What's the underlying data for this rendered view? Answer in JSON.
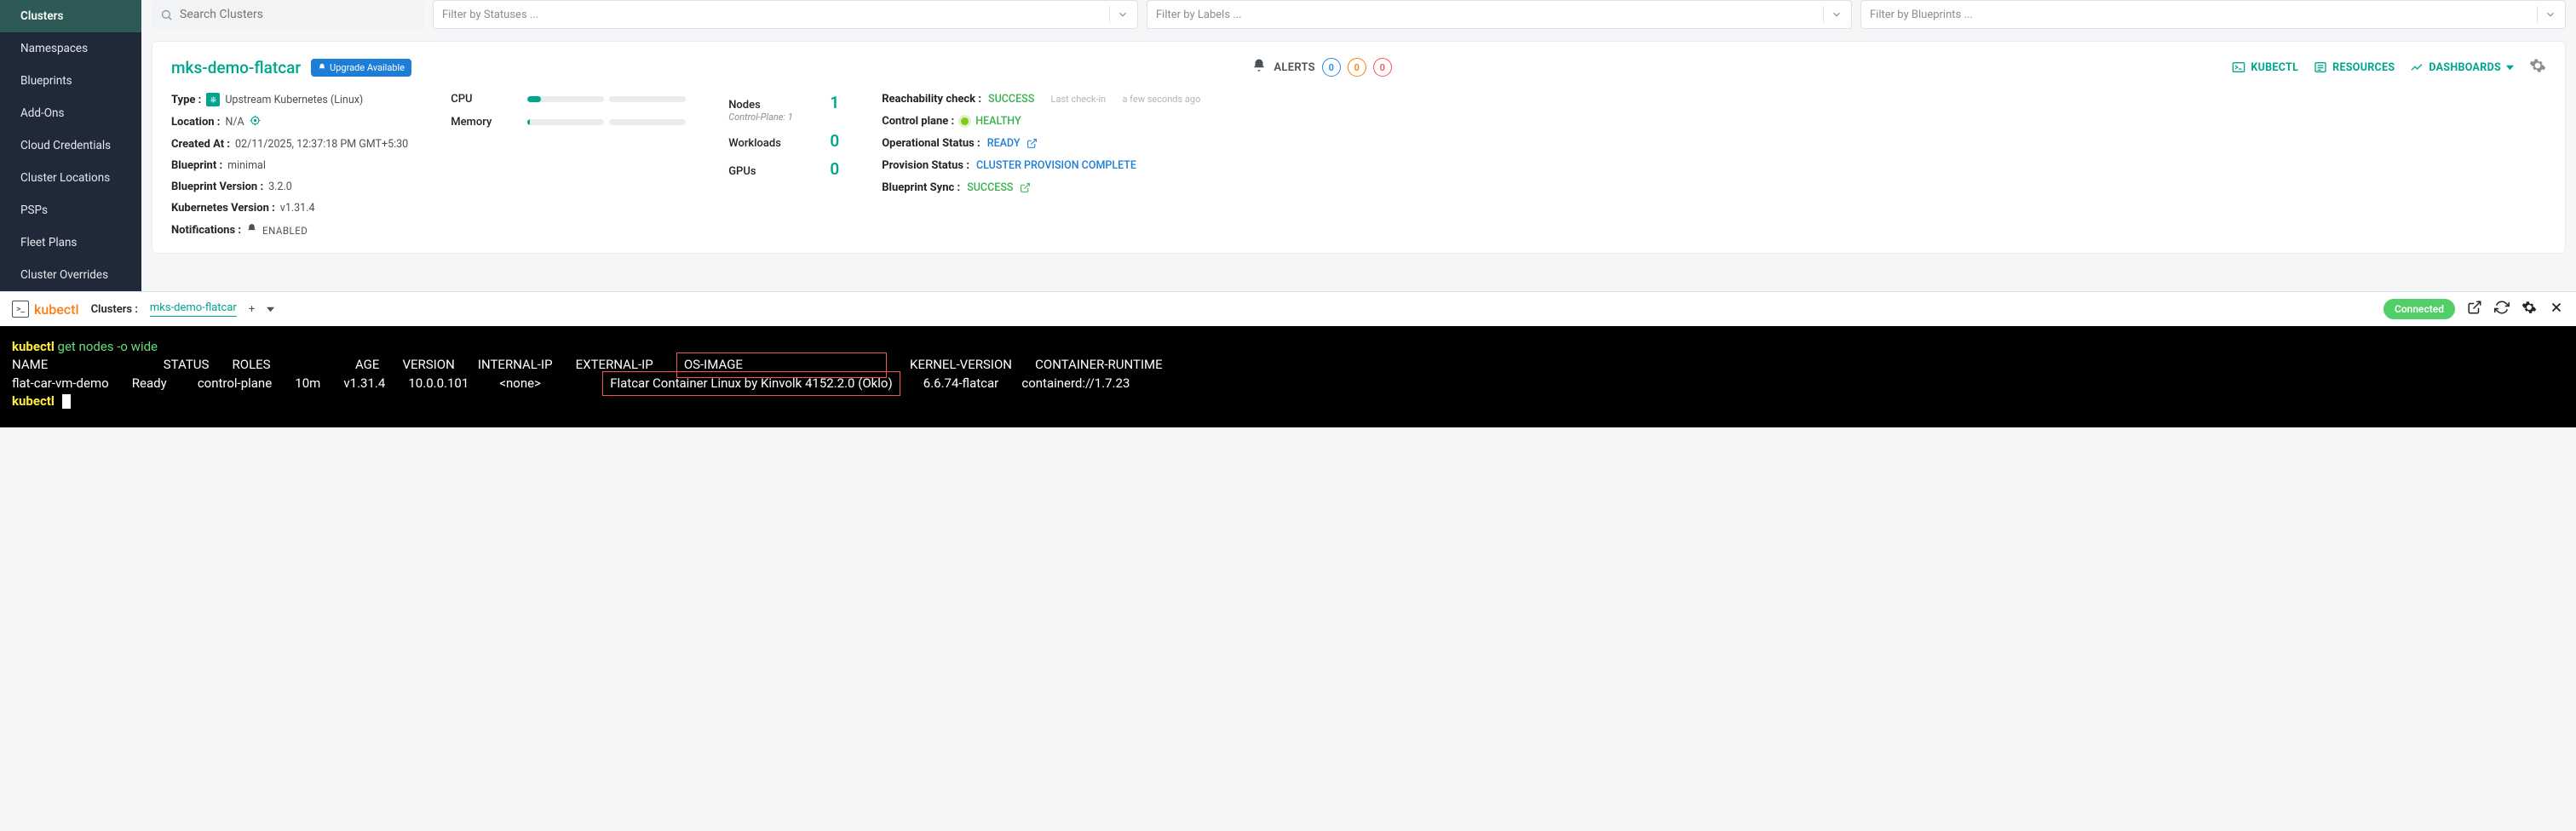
{
  "sidebar": {
    "items": [
      {
        "label": "Clusters",
        "active": true
      },
      {
        "label": "Namespaces"
      },
      {
        "label": "Blueprints"
      },
      {
        "label": "Add-Ons"
      },
      {
        "label": "Cloud Credentials"
      },
      {
        "label": "Cluster Locations"
      },
      {
        "label": "PSPs"
      },
      {
        "label": "Fleet Plans"
      },
      {
        "label": "Cluster Overrides"
      }
    ]
  },
  "filters": {
    "search_placeholder": "Search Clusters",
    "status": "Filter by Statuses ...",
    "labels": "Filter by Labels ...",
    "blueprints": "Filter by Blueprints ..."
  },
  "cluster": {
    "name": "mks-demo-flatcar",
    "upgrade_badge": "Upgrade Available",
    "alerts_label": "ALERTS",
    "alerts": {
      "blue": "0",
      "orange": "0",
      "red": "0"
    },
    "actions": {
      "kubectl": "KUBECTL",
      "resources": "RESOURCES",
      "dashboards": "DASHBOARDS"
    },
    "info": {
      "type_label": "Type :",
      "type_value": "Upstream Kubernetes (Linux)",
      "location_label": "Location :",
      "location_value": "N/A",
      "created_label": "Created At :",
      "created_value": "02/11/2025, 12:37:18 PM GMT+5:30",
      "blueprint_label": "Blueprint :",
      "blueprint_value": "minimal",
      "bp_version_label": "Blueprint Version :",
      "bp_version_value": "3.2.0",
      "k8s_version_label": "Kubernetes Version :",
      "k8s_version_value": "v1.31.4",
      "notifications_label": "Notifications :",
      "notifications_value": "ENABLED"
    },
    "usage": {
      "cpu_label": "CPU",
      "memory_label": "Memory",
      "cpu_pct": 18
    },
    "stats": {
      "nodes_label": "Nodes",
      "nodes_value": "1",
      "nodes_sub": "Control-Plane: 1",
      "workloads_label": "Workloads",
      "workloads_value": "0",
      "gpus_label": "GPUs",
      "gpus_value": "0"
    },
    "status": {
      "reach_label": "Reachability check :",
      "reach_value": "SUCCESS",
      "reach_sub1": "Last check-in",
      "reach_sub2": "a few seconds ago",
      "cp_label": "Control plane :",
      "cp_value": "HEALTHY",
      "op_label": "Operational Status :",
      "op_value": "READY",
      "prov_label": "Provision Status :",
      "prov_value": "CLUSTER PROVISION COMPLETE",
      "sync_label": "Blueprint Sync :",
      "sync_value": "SUCCESS"
    }
  },
  "kubectl_bar": {
    "brand": "kubectl",
    "clusters_label": "Clusters :",
    "selected": "mks-demo-flatcar",
    "plus": "+",
    "connected": "Connected"
  },
  "terminal": {
    "prompt": "kubectl",
    "command": " get nodes -o wide",
    "header": {
      "name": "NAME",
      "status": "STATUS",
      "roles": "ROLES",
      "age": "AGE",
      "version": "VERSION",
      "intip": "INTERNAL-IP",
      "extip": "EXTERNAL-IP",
      "os": "OS-IMAGE",
      "kernel": "KERNEL-VERSION",
      "runtime": "CONTAINER-RUNTIME"
    },
    "row": {
      "name": "flat-car-vm-demo",
      "status": "Ready",
      "roles": "control-plane",
      "age": "10m",
      "version": "v1.31.4",
      "intip": "10.0.0.101",
      "extip": "<none>",
      "os": "Flatcar Container Linux by Kinvolk 4152.2.0 (Oklo)",
      "kernel": "6.6.74-flatcar",
      "runtime": "containerd://1.7.23"
    }
  }
}
